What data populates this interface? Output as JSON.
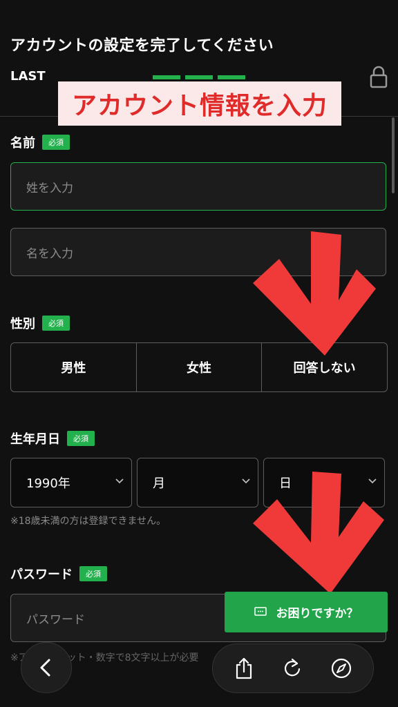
{
  "header": {
    "title": "アカウントの設定を完了してください",
    "step_label": "LAST"
  },
  "banner": {
    "text": "アカウント情報を入力"
  },
  "form": {
    "name": {
      "label": "名前",
      "required": "必須",
      "last_placeholder": "姓を入力",
      "first_placeholder": "名を入力"
    },
    "gender": {
      "label": "性別",
      "required": "必須",
      "options": [
        "男性",
        "女性",
        "回答しない"
      ]
    },
    "birthdate": {
      "label": "生年月日",
      "required": "必須",
      "year": "1990年",
      "month": "月",
      "day": "日",
      "note": "※18歳未満の方は登録できません。"
    },
    "password": {
      "label": "パスワード",
      "required": "必須",
      "placeholder": "パスワード",
      "note": "※アルファベット・数字で8文字以上が必要"
    }
  },
  "help_button": {
    "label": "お困りですか？"
  },
  "colors": {
    "accent": "#22b14c",
    "banner_text": "#e02b2b",
    "arrow": "#f03a3a"
  },
  "icons": [
    "lock-icon",
    "chevron-down-icon",
    "chat-icon",
    "back-icon",
    "share-icon",
    "reload-icon",
    "compass-icon"
  ]
}
